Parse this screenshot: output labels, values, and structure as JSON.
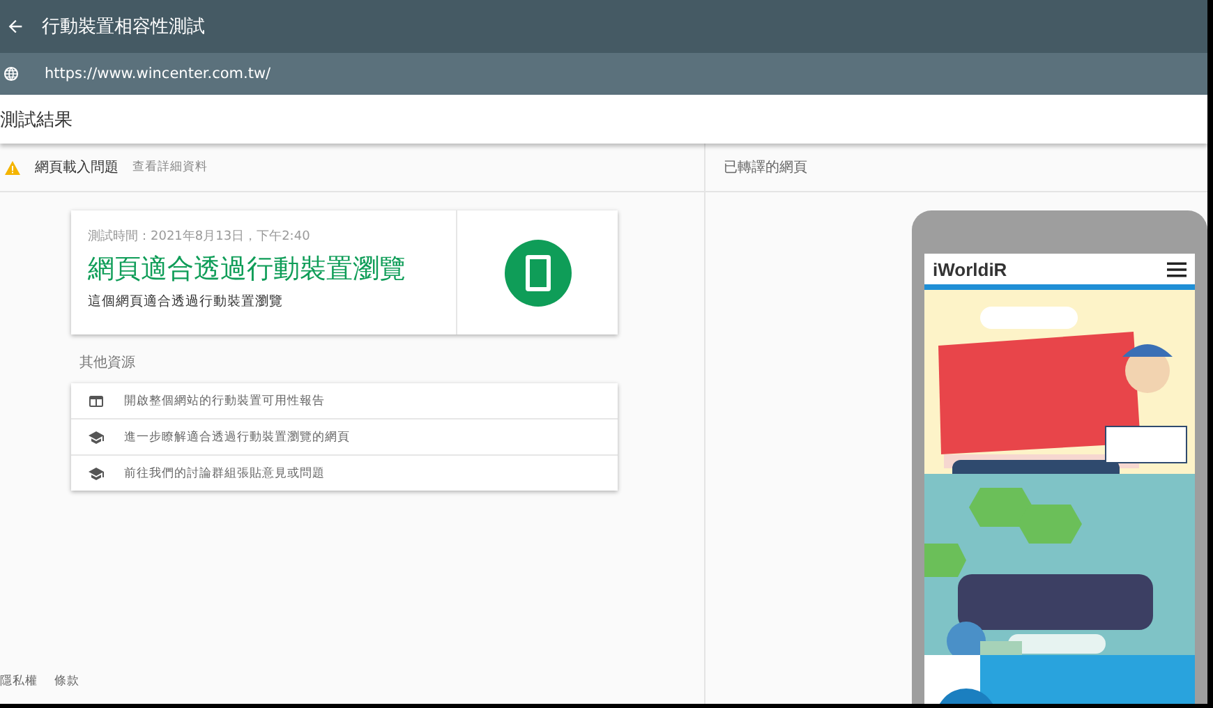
{
  "app_bar": {
    "title": "行動裝置相容性測試"
  },
  "url_bar": {
    "url": "https://www.wincenter.com.tw/"
  },
  "results_header": {
    "title": "測試結果"
  },
  "issue_bar": {
    "label": "網頁載入問題",
    "link": "查看詳細資料"
  },
  "result_card": {
    "test_time": "測試時間：2021年8月13日，下午2:40",
    "headline": "網頁適合透過行動裝置瀏覽",
    "description": "這個網頁適合透過行動裝置瀏覽"
  },
  "resources": {
    "title": "其他資源",
    "items": [
      {
        "kind": "report",
        "label": "開啟整個網站的行動裝置可用性報告"
      },
      {
        "kind": "learn",
        "label": "進一步瞭解適合透過行動裝置瀏覽的網頁"
      },
      {
        "kind": "learn",
        "label": "前往我們的討論群組張貼意見或問題"
      }
    ]
  },
  "footer": {
    "links": [
      "隱私權",
      "條款"
    ]
  },
  "rendered_panel": {
    "title": "已轉譯的網頁",
    "site_logo": "iWorldiR"
  }
}
